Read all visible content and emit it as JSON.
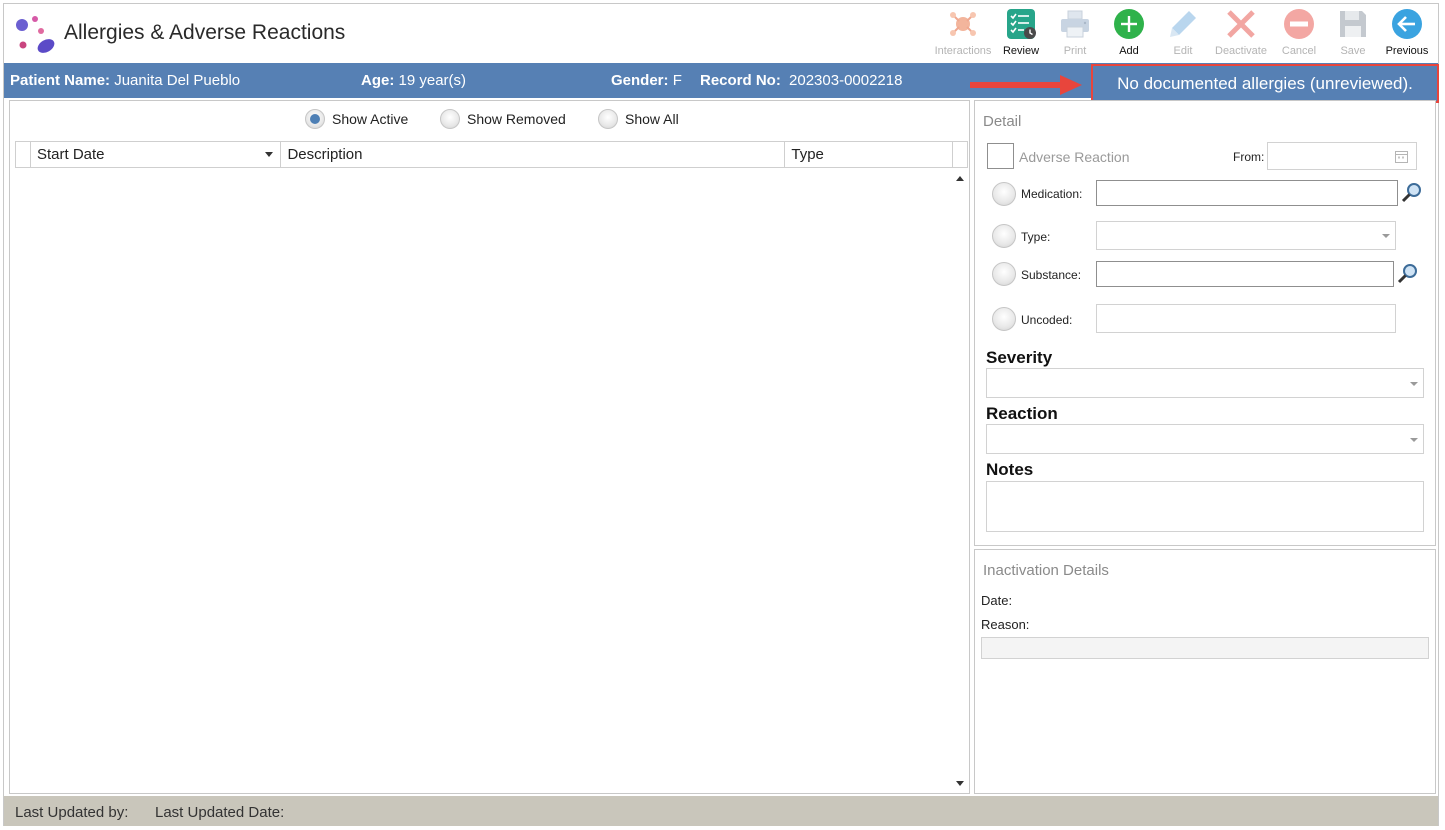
{
  "window": {
    "title": "Allergies & Adverse Reactions"
  },
  "toolbar": {
    "buttons": [
      {
        "label": "Interactions",
        "icon": "interactions-icon",
        "enabled": false
      },
      {
        "label": "Review",
        "icon": "review-checklist-icon",
        "enabled": true
      },
      {
        "label": "Print",
        "icon": "printer-icon",
        "enabled": false
      },
      {
        "label": "Add",
        "icon": "add-icon",
        "enabled": true
      },
      {
        "label": "Edit",
        "icon": "pencil-icon",
        "enabled": false
      },
      {
        "label": "Deactivate",
        "icon": "x-icon",
        "enabled": false
      },
      {
        "label": "Cancel",
        "icon": "cancel-icon",
        "enabled": false
      },
      {
        "label": "Save",
        "icon": "save-icon",
        "enabled": false
      },
      {
        "label": "Previous",
        "icon": "back-arrow-icon",
        "enabled": true
      }
    ]
  },
  "patient": {
    "name_label": "Patient Name:",
    "name": "Juanita Del Pueblo",
    "age_label": "Age:",
    "age": "19 year(s)",
    "gender_label": "Gender:",
    "gender": "F",
    "record_label": "Record No:",
    "record": "202303-0002218"
  },
  "alert": {
    "text": "No documented allergies (unreviewed)."
  },
  "filters": {
    "options": [
      "Show Active",
      "Show Removed",
      "Show All"
    ],
    "selected": "Show Active"
  },
  "grid": {
    "columns": [
      "Start Date",
      "Description",
      "Type"
    ],
    "rows": []
  },
  "detail": {
    "title": "Detail",
    "adverse_reaction_label": "Adverse Reaction",
    "from_label": "From:",
    "medication_label": "Medication:",
    "type_label": "Type:",
    "substance_label": "Substance:",
    "uncoded_label": "Uncoded:",
    "severity_label": "Severity",
    "reaction_label": "Reaction",
    "notes_label": "Notes"
  },
  "inactivation": {
    "title": "Inactivation Details",
    "date_label": "Date:",
    "reason_label": "Reason:"
  },
  "status_bar": {
    "last_updated_by_label": "Last Updated by:",
    "last_updated_date_label": "Last Updated Date:"
  },
  "colors": {
    "patient_bar": "#5680b4",
    "alert_border": "#e8453c",
    "arrow": "#e8453c",
    "status_bar": "#c9c6bb",
    "radio_checked": "#4d7fb5"
  }
}
